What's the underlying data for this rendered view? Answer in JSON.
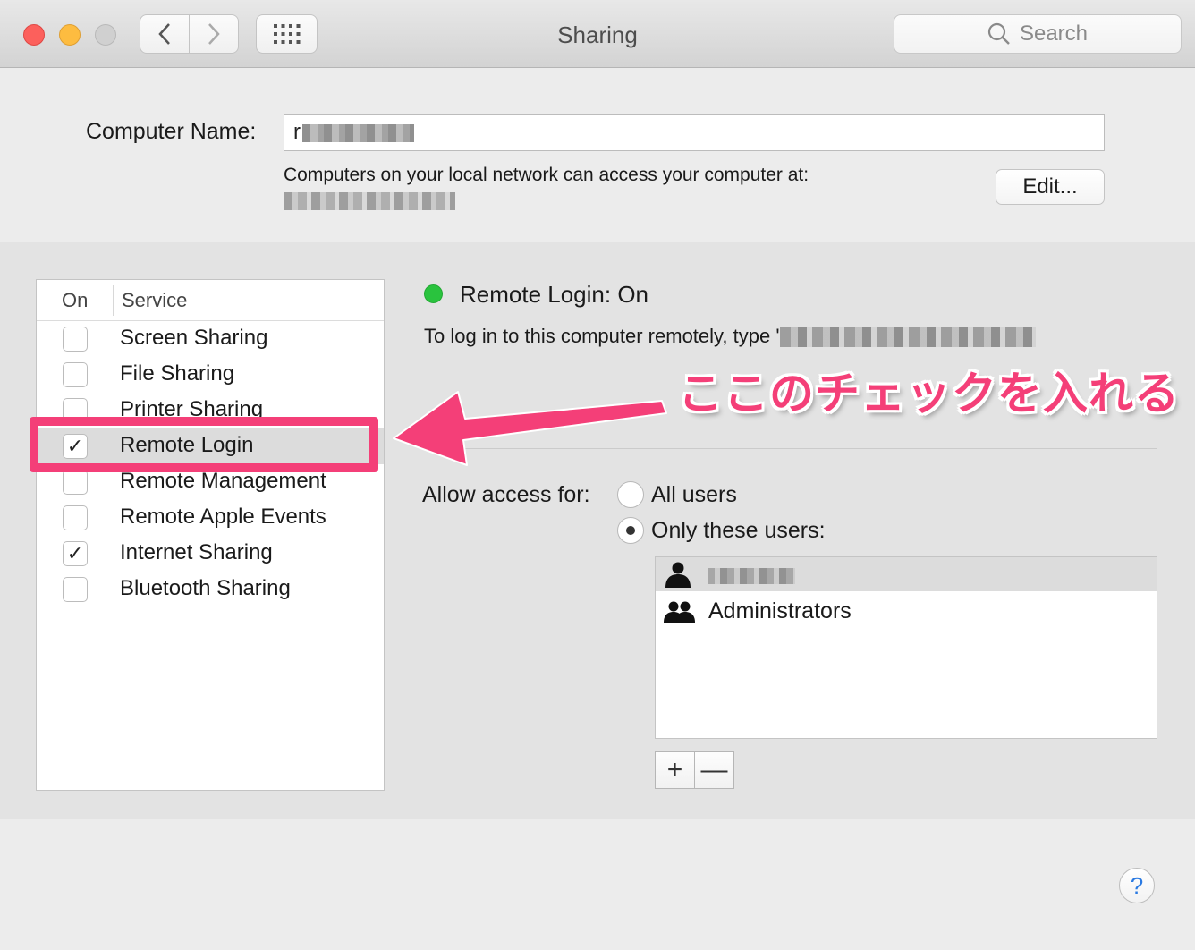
{
  "window": {
    "title": "Sharing",
    "search_placeholder": "Search"
  },
  "computer_name": {
    "label": "Computer Name:",
    "value": "r",
    "description": "Computers on your local network can access your computer at:",
    "edit_label": "Edit..."
  },
  "services": {
    "header_on": "On",
    "header_service": "Service",
    "items": [
      {
        "label": "Screen Sharing",
        "checked": false,
        "selected": false
      },
      {
        "label": "File Sharing",
        "checked": false,
        "selected": false
      },
      {
        "label": "Printer Sharing",
        "checked": false,
        "selected": false
      },
      {
        "label": "Remote Login",
        "checked": true,
        "selected": true
      },
      {
        "label": "Remote Management",
        "checked": false,
        "selected": false
      },
      {
        "label": "Remote Apple Events",
        "checked": false,
        "selected": false
      },
      {
        "label": "Internet Sharing",
        "checked": true,
        "selected": false
      },
      {
        "label": "Bluetooth Sharing",
        "checked": false,
        "selected": false
      }
    ],
    "check_glyph": "✓"
  },
  "detail": {
    "status": "Remote Login: On",
    "status_color": "#2ac33e",
    "login_hint": "To log in to this computer remotely, type '",
    "access_label": "Allow access for:",
    "option_all": "All users",
    "option_only": "Only these users:",
    "selected_option": "only",
    "users": [
      {
        "name": "",
        "icon": "user-icon",
        "selected": true
      },
      {
        "name": "Administrators",
        "icon": "group-icon",
        "selected": false
      }
    ],
    "add_label": "+",
    "remove_label": "—"
  },
  "help_label": "?",
  "annotation": {
    "text": "ここのチェックを入れる",
    "color": "#f43f78"
  }
}
